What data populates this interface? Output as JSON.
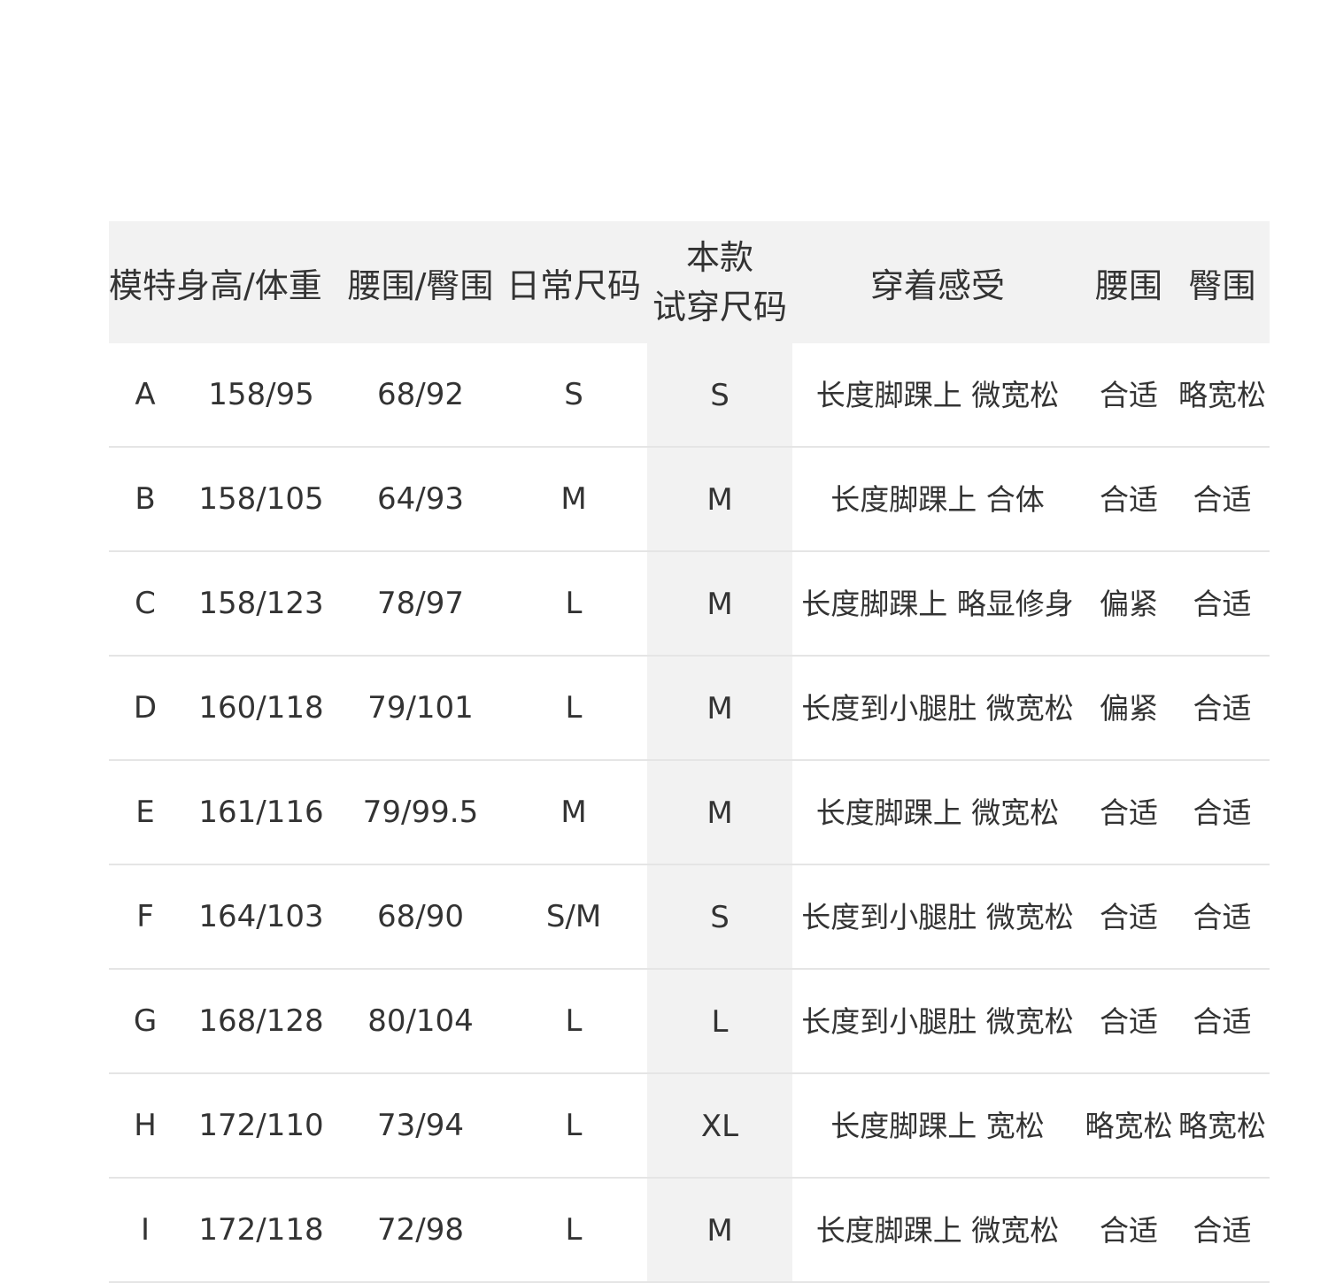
{
  "headers": {
    "model_height_weight": "模特身高/体重",
    "waist_hip": "腰围/臀围",
    "daily_size": "日常尺码",
    "tryon_size_line1": "本款",
    "tryon_size_line2": "试穿尺码",
    "wear_feel": "穿着感受",
    "waist": "腰围",
    "hip": "臀围"
  },
  "rows": [
    {
      "model": "A",
      "height_weight": "158/95",
      "waist_hip": "68/92",
      "daily": "S",
      "tryon": "S",
      "feel": "长度脚踝上 微宽松",
      "waist": "合适",
      "hip": "略宽松"
    },
    {
      "model": "B",
      "height_weight": "158/105",
      "waist_hip": "64/93",
      "daily": "M",
      "tryon": "M",
      "feel": "长度脚踝上 合体",
      "waist": "合适",
      "hip": "合适"
    },
    {
      "model": "C",
      "height_weight": "158/123",
      "waist_hip": "78/97",
      "daily": "L",
      "tryon": "M",
      "feel": "长度脚踝上 略显修身",
      "waist": "偏紧",
      "hip": "合适"
    },
    {
      "model": "D",
      "height_weight": "160/118",
      "waist_hip": "79/101",
      "daily": "L",
      "tryon": "M",
      "feel": "长度到小腿肚 微宽松",
      "waist": "偏紧",
      "hip": "合适"
    },
    {
      "model": "E",
      "height_weight": "161/116",
      "waist_hip": "79/99.5",
      "daily": "M",
      "tryon": "M",
      "feel": "长度脚踝上 微宽松",
      "waist": "合适",
      "hip": "合适"
    },
    {
      "model": "F",
      "height_weight": "164/103",
      "waist_hip": "68/90",
      "daily": "S/M",
      "tryon": "S",
      "feel": "长度到小腿肚 微宽松",
      "waist": "合适",
      "hip": "合适"
    },
    {
      "model": "G",
      "height_weight": "168/128",
      "waist_hip": "80/104",
      "daily": "L",
      "tryon": "L",
      "feel": "长度到小腿肚 微宽松",
      "waist": "合适",
      "hip": "合适"
    },
    {
      "model": "H",
      "height_weight": "172/110",
      "waist_hip": "73/94",
      "daily": "L",
      "tryon": "XL",
      "feel": "长度脚踝上 宽松",
      "waist": "略宽松",
      "hip": "略宽松"
    },
    {
      "model": "I",
      "height_weight": "172/118",
      "waist_hip": "72/98",
      "daily": "L",
      "tryon": "M",
      "feel": "长度脚踝上 微宽松",
      "waist": "合适",
      "hip": "合适"
    }
  ],
  "colors": {
    "header_bg": "#f2f2f2",
    "tryon_column_bg": "#f2f2f2",
    "divider": "#e5e5e5",
    "text": "#333333"
  }
}
